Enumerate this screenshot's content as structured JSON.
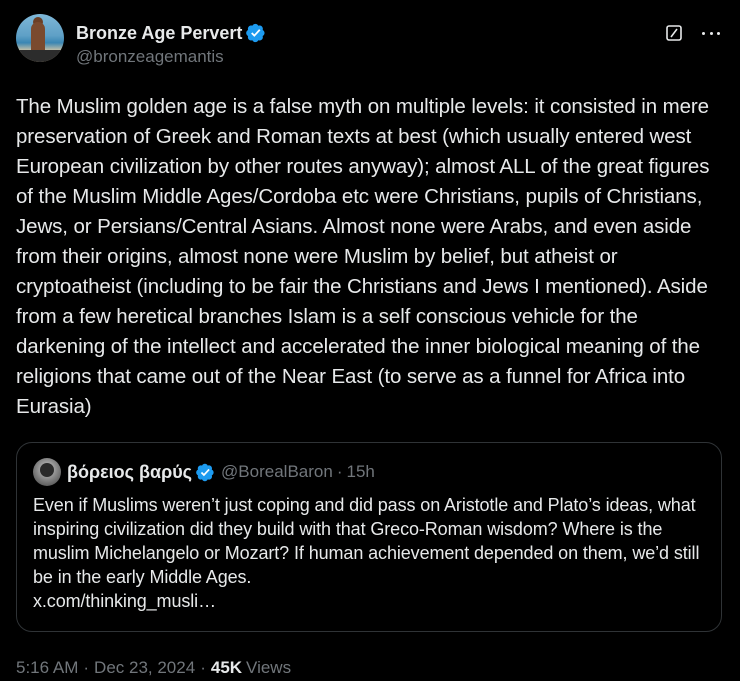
{
  "author": {
    "display_name": "Bronze Age Pervert",
    "handle": "@bronzeagemantis",
    "verified_icon": "verified-badge-icon"
  },
  "tweet": {
    "text": "The Muslim golden age is a false myth on multiple levels: it consisted in mere preservation of Greek and Roman texts at best (which usually entered west European civilization by other routes anyway); almost ALL of the great figures of the Muslim Middle Ages/Cordoba etc were Christians, pupils of Christians, Jews, or Persians/Central Asians. Almost none were Arabs, and even aside from their origins, almost none were Muslim by belief, but atheist or cryptoatheist (including to be fair the Christians and Jews I mentioned). Aside from a few heretical branches Islam is a self conscious vehicle for the darkening of the intellect and accelerated the inner biological meaning of the religions that came out of the Near East (to serve as a funnel for Africa into Eurasia)"
  },
  "quote": {
    "display_name": "βόρειος βαρύς",
    "handle": "@BorealBaron",
    "separator": "·",
    "time": "15h",
    "text": "Even if Muslims weren’t just coping and did pass on Aristotle and Plato’s ideas, what inspiring civilization did they build with that Greco-Roman wisdom? Where is the muslim Michelangelo or Mozart? If human achievement depended on them, we’d still be in the early Middle Ages.",
    "link": "x.com/thinking_musli…"
  },
  "footer": {
    "time": "5:16 AM",
    "separator": "·",
    "date": "Dec 23, 2024",
    "views_count": "45K",
    "views_label": "Views"
  },
  "colors": {
    "background": "#000000",
    "text": "#e7e9ea",
    "muted": "#71767b",
    "verified": "#1d9bf0",
    "border": "#2f3336"
  },
  "icons": {
    "grok": "grok-icon",
    "more": "more-icon"
  }
}
